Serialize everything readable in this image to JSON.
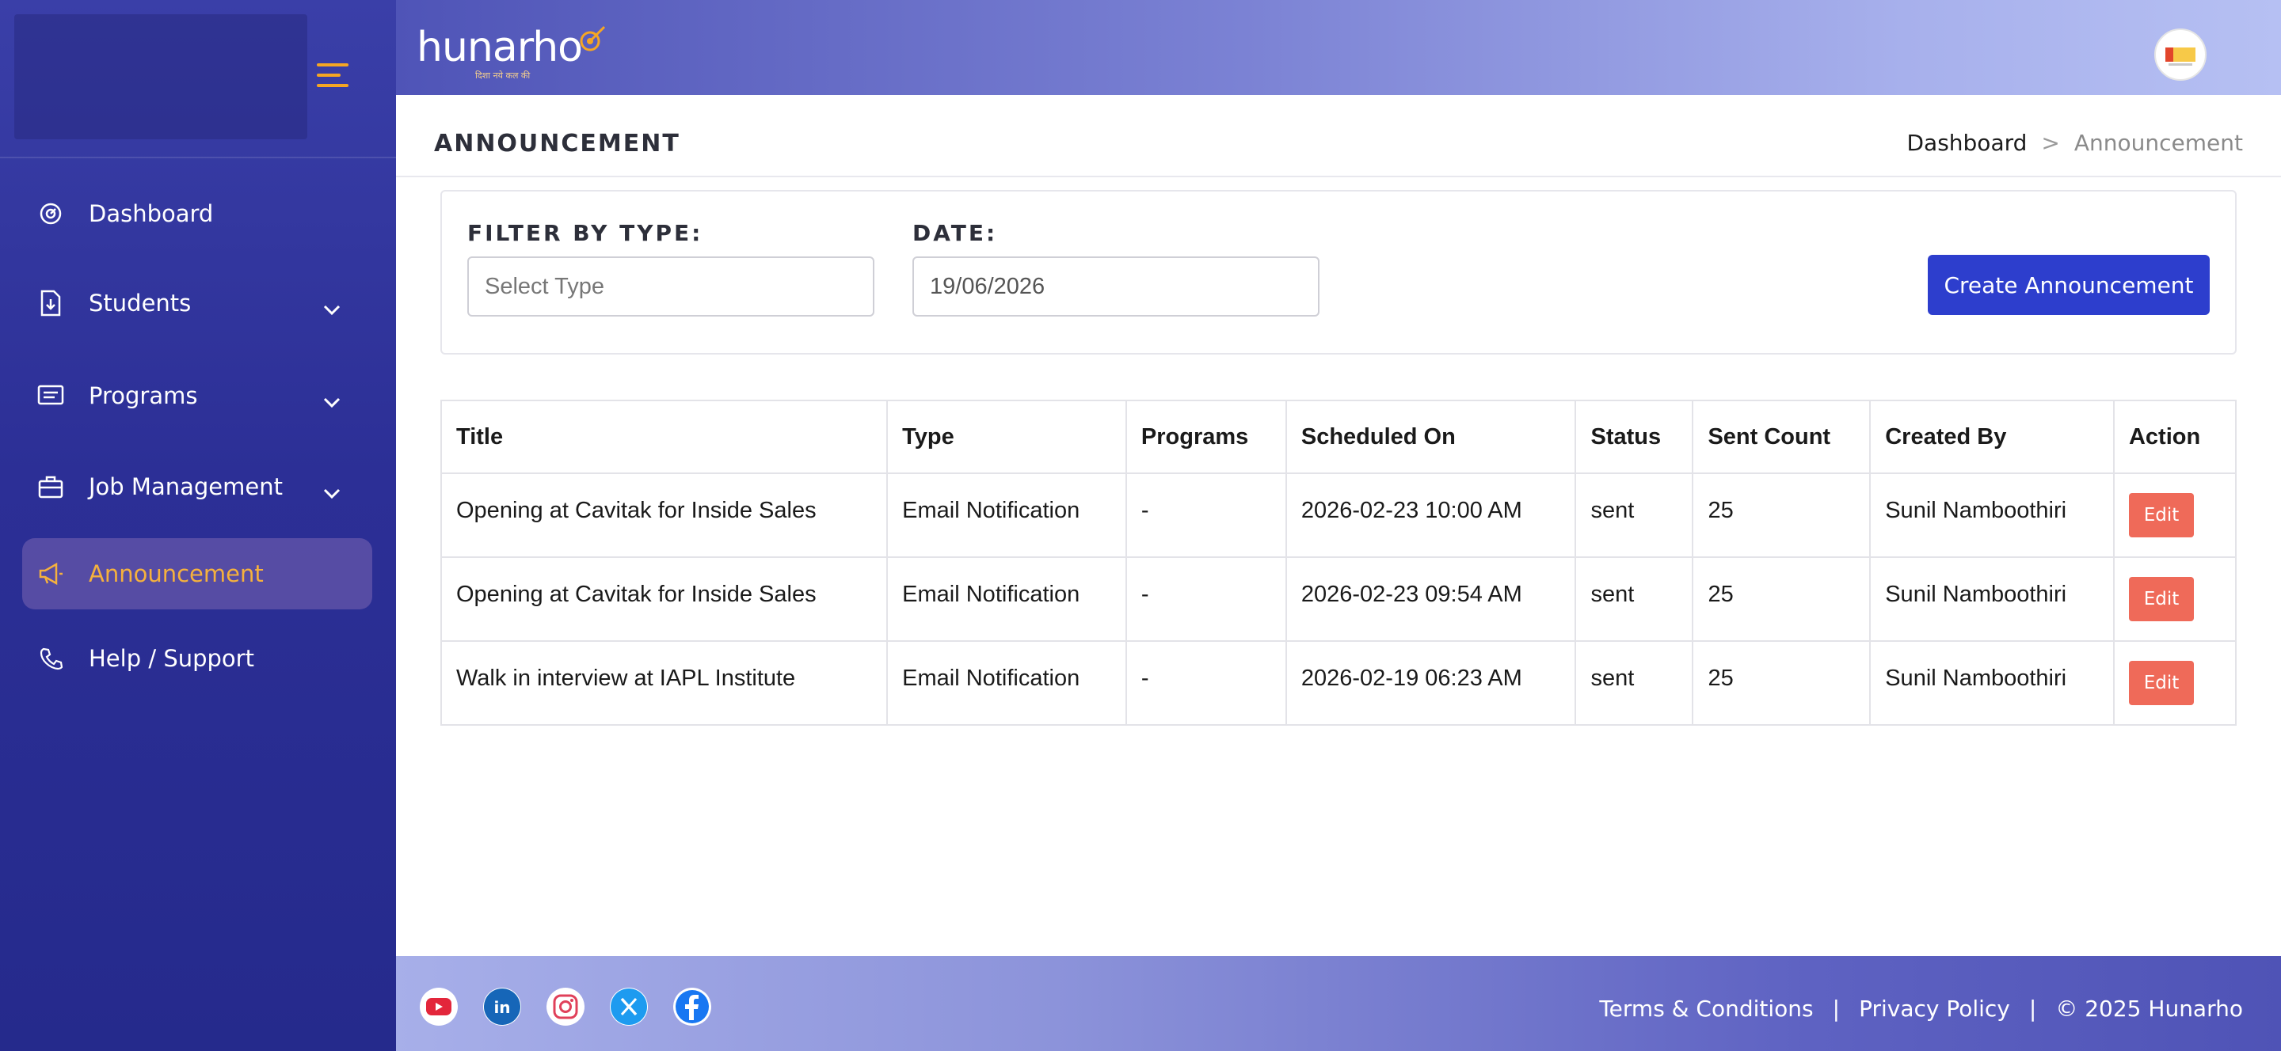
{
  "header": {
    "brand": "hunarho",
    "brand_tagline": "दिशा नये कल की"
  },
  "sidebar": {
    "items": [
      {
        "label": "Dashboard"
      },
      {
        "label": "Students"
      },
      {
        "label": "Programs"
      },
      {
        "label": "Job Management"
      },
      {
        "label": "Announcement"
      },
      {
        "label": "Help / Support"
      }
    ],
    "active": "Announcement"
  },
  "page": {
    "title": "ANNOUNCEMENT"
  },
  "breadcrumb": {
    "home": "Dashboard",
    "separator": ">",
    "current": "Announcement"
  },
  "filters": {
    "type_label": "FILTER BY TYPE:",
    "type_placeholder": "Select Type",
    "date_label": "DATE:",
    "date_value": "19/06/2026",
    "create_label": "Create Announcement"
  },
  "table": {
    "columns": [
      "Title",
      "Type",
      "Programs",
      "Scheduled On",
      "Status",
      "Sent Count",
      "Created By",
      "Action"
    ],
    "rows": [
      {
        "title": "Opening at Cavitak for Inside Sales",
        "type": "Email Notification",
        "programs": "-",
        "scheduled": "2026-02-23 10:00 AM",
        "status": "sent",
        "sent": "25",
        "created_by": "Sunil Namboothiri",
        "action": "Edit"
      },
      {
        "title": "Opening at Cavitak for Inside Sales",
        "type": "Email Notification",
        "programs": "-",
        "scheduled": "2026-02-23 09:54 AM",
        "status": "sent",
        "sent": "25",
        "created_by": "Sunil Namboothiri",
        "action": "Edit"
      },
      {
        "title": "Walk in interview at IAPL Institute",
        "type": "Email Notification",
        "programs": "-",
        "scheduled": "2026-02-19 06:23 AM",
        "status": "sent",
        "sent": "25",
        "created_by": "Sunil Namboothiri",
        "action": "Edit"
      }
    ]
  },
  "footer": {
    "social_icons": [
      "youtube-icon",
      "linkedin-icon",
      "instagram-icon",
      "x-icon",
      "facebook-icon"
    ],
    "terms": "Terms & Conditions",
    "divider": "|",
    "privacy": "Privacy Policy",
    "copyright": "© 2025 Hunarho"
  },
  "colors": {
    "primary": "#2d3ecd",
    "sidebar": "#2c2f96",
    "accent": "#f5a623",
    "edit": "#ef6a59"
  }
}
